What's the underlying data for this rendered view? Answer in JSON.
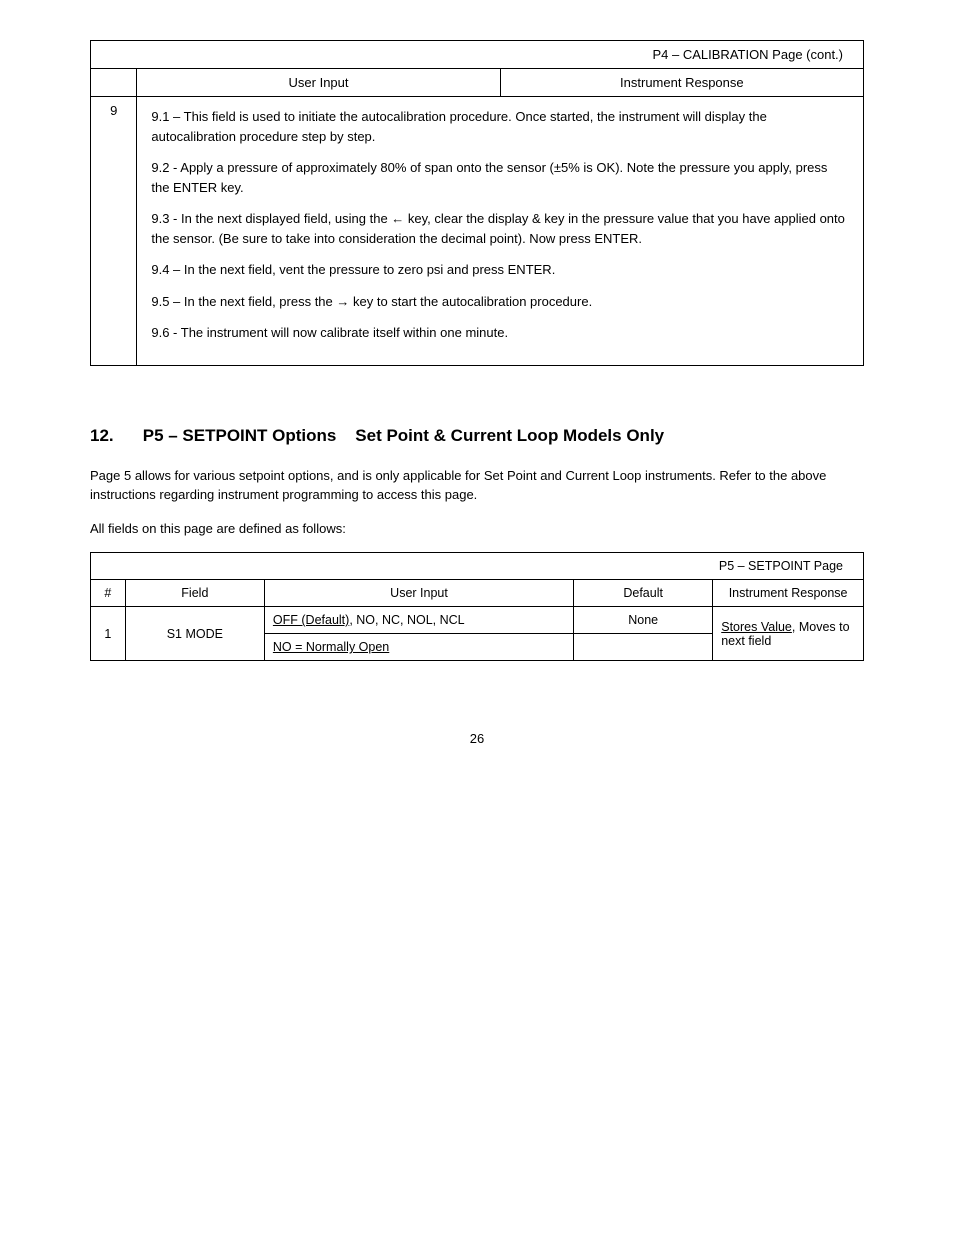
{
  "table1": {
    "title": "P4 – CALIBRATION Page (cont.)",
    "header_input": "User Input",
    "header_response": "Instrument Response",
    "row_num": "9",
    "instructions": [
      "9.1 – This field is used to initiate the autocalibration procedure. Once started, the instrument will display the autocalibration procedure step by step.",
      "9.2 - Apply a pressure of approximately 80% of span onto the sensor (±5% is OK). Note the pressure you apply, press the ENTER key.",
      "9.3 - In the next displayed field, using the ← key, clear the display & key in the pressure value that you have applied onto the sensor. (Be sure to take into consideration the decimal point). Now press ENTER.",
      "9.4 – In the next field, vent the pressure to zero psi and press ENTER.",
      "9.5 – In the next field, press the → key to start the autocalibration procedure.",
      "9.6 - The instrument will now calibrate itself within one minute."
    ]
  },
  "section": {
    "number": "12.",
    "title_prefix": "P5 – SETPOINT Options",
    "title_suffix": "Set Point & Current Loop Models Only"
  },
  "paragraphs": [
    "Page 5 allows for various setpoint options, and is only applicable for Set Point and Current Loop instruments. Refer to the above instructions regarding instrument programming to access this page.",
    "All fields on this page are defined as follows:"
  ],
  "table2": {
    "title": "P5 – SETPOINT Page",
    "headers": {
      "num": "#",
      "field": "Field",
      "input": "User Input",
      "default": "Default",
      "response": "Instrument Response"
    },
    "rows": [
      {
        "num": "1",
        "field": "S1 MODE",
        "inputs": [
          {
            "label_ul": "OFF (Default)",
            "label_rest": ", NO, NC, NOL, NCL",
            "default": "None"
          },
          {
            "label_ul": "NO = Normally Open",
            "label_rest": "",
            "default": ""
          }
        ],
        "response_ul": "Stores Value",
        "response_rest": ", Moves to next field"
      }
    ]
  },
  "page_number": "26"
}
